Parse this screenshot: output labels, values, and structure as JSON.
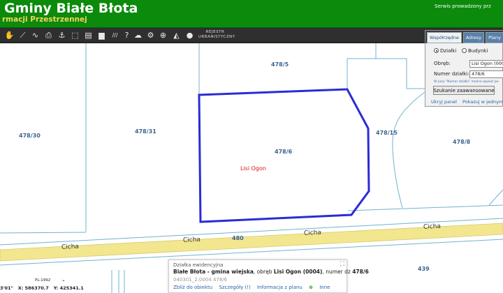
{
  "header": {
    "title": "Gminy Białe Błota",
    "subtitle": "rmacji Przestrzennej",
    "service_text": "Serwis prowadzony prz"
  },
  "toolbar": {
    "tools": [
      {
        "name": "pan-tool-icon",
        "glyph": "✋"
      },
      {
        "name": "measure-distance-icon",
        "glyph": "⟋"
      },
      {
        "name": "measure-area-icon",
        "glyph": "∿"
      },
      {
        "name": "print-icon",
        "glyph": "⎙"
      },
      {
        "name": "anchor-icon",
        "glyph": "⚓"
      },
      {
        "name": "select-area-icon",
        "glyph": "⬚"
      },
      {
        "name": "layers-icon",
        "glyph": "▤"
      },
      {
        "name": "comment-icon",
        "glyph": "▆"
      },
      {
        "name": "hatch-icon",
        "glyph": "///"
      },
      {
        "name": "help-icon",
        "glyph": "?"
      },
      {
        "name": "cloud-icon",
        "glyph": "☁"
      },
      {
        "name": "settings-icon",
        "glyph": "⚙"
      },
      {
        "name": "zoom-icon",
        "glyph": "⊕"
      },
      {
        "name": "shapes-icon",
        "glyph": "◭"
      },
      {
        "name": "chat-icon",
        "glyph": "●"
      }
    ],
    "register_label": "REJESTR URBANISTYCZNY"
  },
  "panel": {
    "tabs": [
      "Współrzędne",
      "Adresy",
      "Plany"
    ],
    "radio_dzialki": "Działki",
    "radio_budynki": "Budynki",
    "obreb_label": "Obręb:",
    "obreb_value": "Lisi Ogon (0004",
    "numer_label": "Numer działki:",
    "numer_value": "478/6",
    "hint": "W polu \"Numer działki\" można wpisać pe",
    "search_button": "Szukanie zaawansowane",
    "link_hide": "Ukryj panel",
    "link_show": "Pokazuj w jednym okn"
  },
  "map": {
    "parcels": [
      "478/5",
      "478/30",
      "478/31",
      "478/15",
      "478/6",
      "478/8",
      "480",
      "439"
    ],
    "place_name": "Lisi Ogon",
    "roads": [
      "Cicha",
      "Cicha",
      "Cicha",
      "Cicha"
    ],
    "highlight_color": "#2b2bd6",
    "road_color": "#f2e78f"
  },
  "popup": {
    "title": "Działka ewidencyjna",
    "line_name": "Białe Błota - gmina wiejska",
    "line_obreb_pre": ", obręb ",
    "line_obreb": "Lisi Ogon (0004)",
    "line_num_pre": ", numer dz ",
    "line_num": "478/6",
    "identifier": "040301_2.0004.478/6",
    "actions": [
      "Zbliż do obiektu",
      "Szczegóły (!)",
      "Informacja z planu",
      "Inne"
    ]
  },
  "coords": {
    "system": "PL-1992",
    "left_value": "3'01\"",
    "x_label": "X:",
    "x_value": "586370.7",
    "y_label": "Y:",
    "y_value": "425341.1"
  }
}
